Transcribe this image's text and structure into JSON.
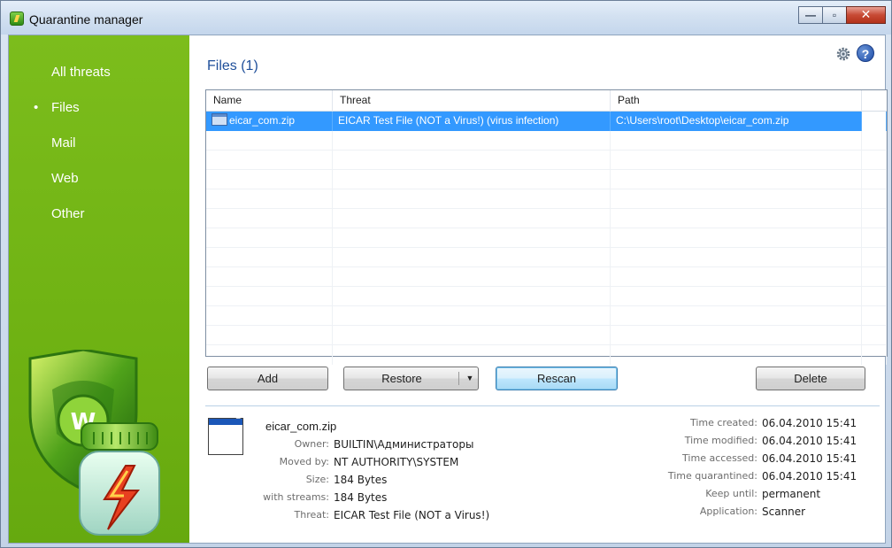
{
  "window": {
    "title": "Quarantine manager",
    "minimize_glyph": "—",
    "maximize_glyph": "▫",
    "close_glyph": "✕"
  },
  "sidebar": {
    "items": [
      {
        "label": "All threats",
        "active": false
      },
      {
        "label": "Files",
        "active": true
      },
      {
        "label": "Mail",
        "active": false
      },
      {
        "label": "Web",
        "active": false
      },
      {
        "label": "Other",
        "active": false
      }
    ],
    "background_color": "#74b817"
  },
  "header": {
    "section_title": "Files (1)",
    "help_glyph": "?",
    "icons": [
      "settings-icon",
      "help-icon"
    ]
  },
  "table": {
    "columns": [
      "Name",
      "Threat",
      "Path"
    ],
    "rows": [
      {
        "name": "eicar_com.zip",
        "threat": "EICAR Test File (NOT a Virus!) (virus infection)",
        "path": "C:\\Users\\root\\Desktop\\eicar_com.zip",
        "selected": true
      }
    ],
    "selection_color": "#3399ff"
  },
  "buttons": {
    "add": "Add",
    "restore": "Restore",
    "restore_dropdown": "▼",
    "rescan": "Rescan",
    "delete": "Delete"
  },
  "details": {
    "file_name": "eicar_com.zip",
    "left": [
      {
        "key": "Owner:",
        "value": "BUILTIN\\Администраторы"
      },
      {
        "key": "Moved by:",
        "value": "NT AUTHORITY\\SYSTEM"
      },
      {
        "key": "Size:",
        "value": "184 Bytes"
      },
      {
        "key": "with streams:",
        "value": "184 Bytes"
      },
      {
        "key": "Threat:",
        "value": "EICAR Test File (NOT a Virus!)"
      }
    ],
    "right": [
      {
        "key": "Time created:",
        "value": "06.04.2010 15:41"
      },
      {
        "key": "Time modified:",
        "value": "06.04.2010 15:41"
      },
      {
        "key": "Time accessed:",
        "value": "06.04.2010 15:41"
      },
      {
        "key": "Time quarantined:",
        "value": "06.04.2010 15:41"
      },
      {
        "key": "Keep until:",
        "value": "permanent"
      },
      {
        "key": "Application:",
        "value": "Scanner"
      }
    ]
  }
}
